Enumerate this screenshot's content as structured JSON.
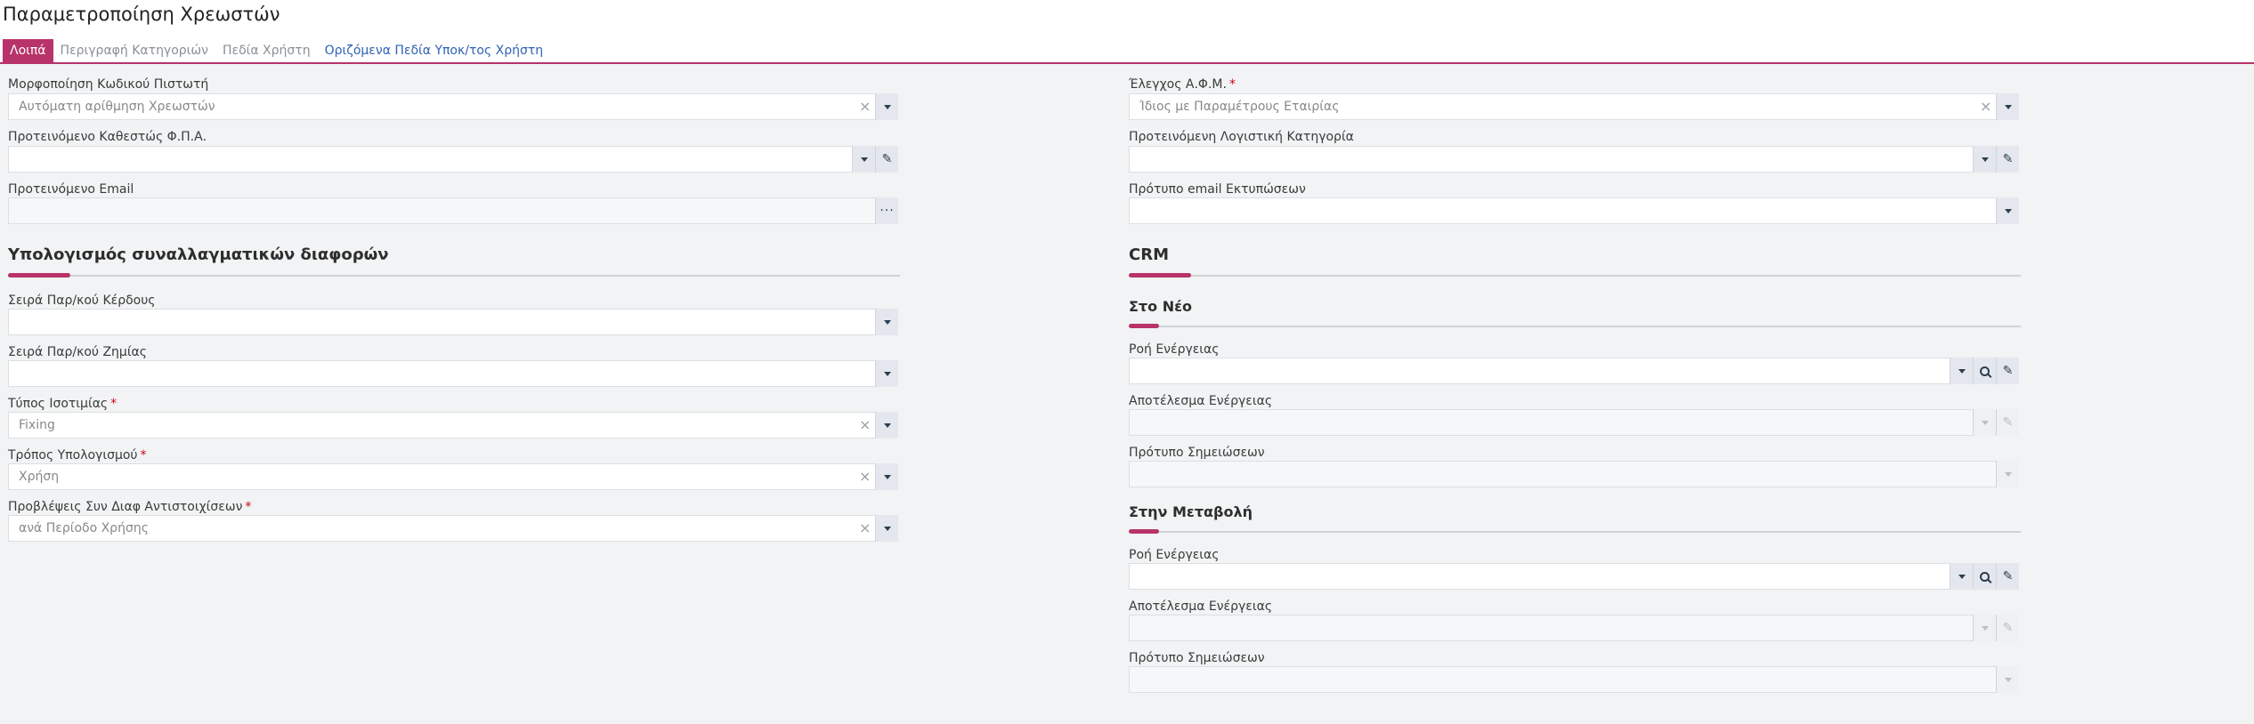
{
  "page": {
    "title": "Παραμετροποίηση Χρεωστών"
  },
  "tabs": [
    {
      "label": "Λοιπά",
      "active": true
    },
    {
      "label": "Περιγραφή Κατηγοριών",
      "active": false
    },
    {
      "label": "Πεδία Χρήστη",
      "active": false
    },
    {
      "label": "Οριζόμενα Πεδία Υποκ/τος Χρήστη",
      "active": false
    }
  ],
  "left": {
    "field1": {
      "label": "Μορφοποίηση Κωδικού Πιστωτή",
      "value": "Αυτόματη αρίθμηση Χρεωστών"
    },
    "field2": {
      "label": "Προτεινόμενο Καθεστώς Φ.Π.Α.",
      "value": ""
    },
    "field3": {
      "label": "Προτεινόμενο Email",
      "value": ""
    },
    "section": {
      "title": "Υπολογισμός συναλλαγματικών διαφορών"
    },
    "field4": {
      "label": "Σειρά Παρ/κού Κέρδους",
      "value": ""
    },
    "field5": {
      "label": "Σειρά Παρ/κού Ζημίας",
      "value": ""
    },
    "field6": {
      "label": "Τύπος Ισοτιμίας",
      "required": "*",
      "value": "Fixing"
    },
    "field7": {
      "label": "Τρόπος Υπολογισμού",
      "required": "*",
      "value": "Χρήση"
    },
    "field8": {
      "label": "Προβλέψεις Συν Διαφ Αντιστοιχίσεων",
      "required": "*",
      "value": "ανά Περίοδο Χρήσης"
    }
  },
  "right": {
    "field1": {
      "label": "Έλεγχος Α.Φ.Μ.",
      "required": "*",
      "value": "Ίδιος με Παραμέτρους Εταιρίας"
    },
    "field2": {
      "label": "Προτεινόμενη Λογιστική Κατηγορία",
      "value": ""
    },
    "field3": {
      "label": "Πρότυπο email Εκτυπώσεων",
      "value": ""
    },
    "crm": {
      "title": "CRM"
    },
    "new": {
      "title": "Στο Νέο",
      "flow_label": "Ροή Ενέργειας",
      "result_label": "Αποτέλεσμα Ενέργειας",
      "notes_label": "Πρότυπο Σημειώσεων"
    },
    "change": {
      "title": "Στην Μεταβολή",
      "flow_label": "Ροή Ενέργειας",
      "result_label": "Αποτέλεσμα Ενέργειας",
      "notes_label": "Πρότυπο Σημειώσεων"
    }
  },
  "glyphs": {
    "clear": "×",
    "edit": "✎",
    "more": "···"
  },
  "colors": {
    "accent": "#b8336a",
    "link": "#2f62b4",
    "required": "#d0021b"
  }
}
